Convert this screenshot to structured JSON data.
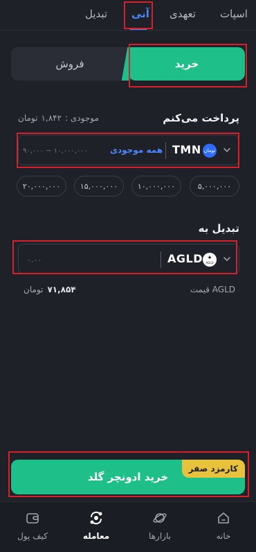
{
  "tabs": [
    {
      "label": "اسپات"
    },
    {
      "label": "تعهدی"
    },
    {
      "label": "آنی"
    },
    {
      "label": "تبدیل"
    }
  ],
  "trade_toggle": {
    "buy": "خرید",
    "sell": "فروش"
  },
  "payment": {
    "title": "پرداخت می‌کنم",
    "balance_label": "موجودی :",
    "balance_value": "۱,۸۴۲",
    "balance_unit": "تومان",
    "currency_code": "TMN",
    "currency_logo_text": "تومان",
    "all_balance": "همه موجودی",
    "range_placeholder": "۹۰,۰۰۰ ~ ۱۰,۰۰۰,۰۰۰"
  },
  "presets": [
    "۵,۰۰۰,۰۰۰",
    "۱۰,۰۰۰,۰۰۰",
    "۱۵,۰۰۰,۰۰۰",
    "۲۰,۰۰۰,۰۰۰"
  ],
  "convert": {
    "title": "تبدیل به",
    "currency_code": "AGLD",
    "currency_logo_text": "AGLD",
    "amount_placeholder": "۰.۰۰",
    "price_label": "قیمت AGLD",
    "price_value": "۷۱,۸۵۴",
    "price_unit": "تومان"
  },
  "cta": {
    "label": "خرید ادونچر گلد",
    "badge": "کارمزد صفر"
  },
  "bottom_nav": [
    {
      "label": "خانه"
    },
    {
      "label": "بازارها"
    },
    {
      "label": "معامله"
    },
    {
      "label": "کیف پول"
    }
  ],
  "colors": {
    "accent": "#1fbf8a",
    "link": "#4c87ff",
    "badge": "#e8c23c",
    "background": "#1f2129"
  }
}
